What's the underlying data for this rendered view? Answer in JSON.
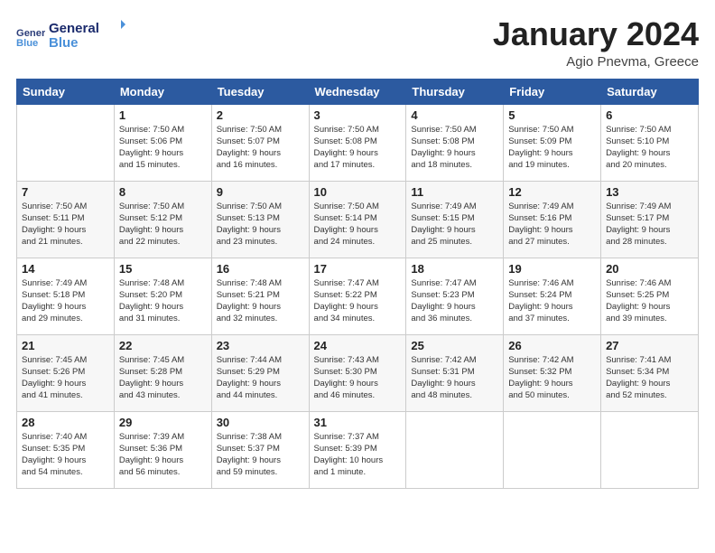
{
  "logo": {
    "text_general": "General",
    "text_blue": "Blue"
  },
  "title": "January 2024",
  "subtitle": "Agio Pnevma, Greece",
  "days_of_week": [
    "Sunday",
    "Monday",
    "Tuesday",
    "Wednesday",
    "Thursday",
    "Friday",
    "Saturday"
  ],
  "weeks": [
    [
      {
        "day": "",
        "info": ""
      },
      {
        "day": "1",
        "info": "Sunrise: 7:50 AM\nSunset: 5:06 PM\nDaylight: 9 hours\nand 15 minutes."
      },
      {
        "day": "2",
        "info": "Sunrise: 7:50 AM\nSunset: 5:07 PM\nDaylight: 9 hours\nand 16 minutes."
      },
      {
        "day": "3",
        "info": "Sunrise: 7:50 AM\nSunset: 5:08 PM\nDaylight: 9 hours\nand 17 minutes."
      },
      {
        "day": "4",
        "info": "Sunrise: 7:50 AM\nSunset: 5:08 PM\nDaylight: 9 hours\nand 18 minutes."
      },
      {
        "day": "5",
        "info": "Sunrise: 7:50 AM\nSunset: 5:09 PM\nDaylight: 9 hours\nand 19 minutes."
      },
      {
        "day": "6",
        "info": "Sunrise: 7:50 AM\nSunset: 5:10 PM\nDaylight: 9 hours\nand 20 minutes."
      }
    ],
    [
      {
        "day": "7",
        "info": "Sunrise: 7:50 AM\nSunset: 5:11 PM\nDaylight: 9 hours\nand 21 minutes."
      },
      {
        "day": "8",
        "info": "Sunrise: 7:50 AM\nSunset: 5:12 PM\nDaylight: 9 hours\nand 22 minutes."
      },
      {
        "day": "9",
        "info": "Sunrise: 7:50 AM\nSunset: 5:13 PM\nDaylight: 9 hours\nand 23 minutes."
      },
      {
        "day": "10",
        "info": "Sunrise: 7:50 AM\nSunset: 5:14 PM\nDaylight: 9 hours\nand 24 minutes."
      },
      {
        "day": "11",
        "info": "Sunrise: 7:49 AM\nSunset: 5:15 PM\nDaylight: 9 hours\nand 25 minutes."
      },
      {
        "day": "12",
        "info": "Sunrise: 7:49 AM\nSunset: 5:16 PM\nDaylight: 9 hours\nand 27 minutes."
      },
      {
        "day": "13",
        "info": "Sunrise: 7:49 AM\nSunset: 5:17 PM\nDaylight: 9 hours\nand 28 minutes."
      }
    ],
    [
      {
        "day": "14",
        "info": "Sunrise: 7:49 AM\nSunset: 5:18 PM\nDaylight: 9 hours\nand 29 minutes."
      },
      {
        "day": "15",
        "info": "Sunrise: 7:48 AM\nSunset: 5:20 PM\nDaylight: 9 hours\nand 31 minutes."
      },
      {
        "day": "16",
        "info": "Sunrise: 7:48 AM\nSunset: 5:21 PM\nDaylight: 9 hours\nand 32 minutes."
      },
      {
        "day": "17",
        "info": "Sunrise: 7:47 AM\nSunset: 5:22 PM\nDaylight: 9 hours\nand 34 minutes."
      },
      {
        "day": "18",
        "info": "Sunrise: 7:47 AM\nSunset: 5:23 PM\nDaylight: 9 hours\nand 36 minutes."
      },
      {
        "day": "19",
        "info": "Sunrise: 7:46 AM\nSunset: 5:24 PM\nDaylight: 9 hours\nand 37 minutes."
      },
      {
        "day": "20",
        "info": "Sunrise: 7:46 AM\nSunset: 5:25 PM\nDaylight: 9 hours\nand 39 minutes."
      }
    ],
    [
      {
        "day": "21",
        "info": "Sunrise: 7:45 AM\nSunset: 5:26 PM\nDaylight: 9 hours\nand 41 minutes."
      },
      {
        "day": "22",
        "info": "Sunrise: 7:45 AM\nSunset: 5:28 PM\nDaylight: 9 hours\nand 43 minutes."
      },
      {
        "day": "23",
        "info": "Sunrise: 7:44 AM\nSunset: 5:29 PM\nDaylight: 9 hours\nand 44 minutes."
      },
      {
        "day": "24",
        "info": "Sunrise: 7:43 AM\nSunset: 5:30 PM\nDaylight: 9 hours\nand 46 minutes."
      },
      {
        "day": "25",
        "info": "Sunrise: 7:42 AM\nSunset: 5:31 PM\nDaylight: 9 hours\nand 48 minutes."
      },
      {
        "day": "26",
        "info": "Sunrise: 7:42 AM\nSunset: 5:32 PM\nDaylight: 9 hours\nand 50 minutes."
      },
      {
        "day": "27",
        "info": "Sunrise: 7:41 AM\nSunset: 5:34 PM\nDaylight: 9 hours\nand 52 minutes."
      }
    ],
    [
      {
        "day": "28",
        "info": "Sunrise: 7:40 AM\nSunset: 5:35 PM\nDaylight: 9 hours\nand 54 minutes."
      },
      {
        "day": "29",
        "info": "Sunrise: 7:39 AM\nSunset: 5:36 PM\nDaylight: 9 hours\nand 56 minutes."
      },
      {
        "day": "30",
        "info": "Sunrise: 7:38 AM\nSunset: 5:37 PM\nDaylight: 9 hours\nand 59 minutes."
      },
      {
        "day": "31",
        "info": "Sunrise: 7:37 AM\nSunset: 5:39 PM\nDaylight: 10 hours\nand 1 minute."
      },
      {
        "day": "",
        "info": ""
      },
      {
        "day": "",
        "info": ""
      },
      {
        "day": "",
        "info": ""
      }
    ]
  ]
}
